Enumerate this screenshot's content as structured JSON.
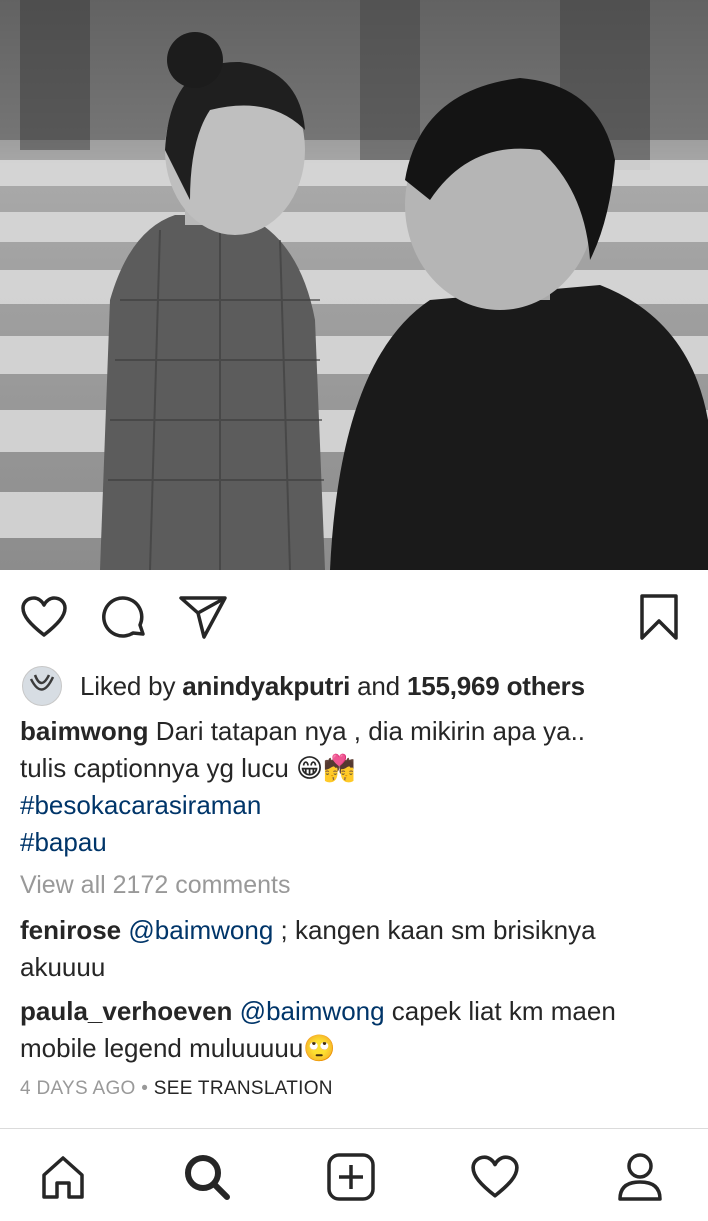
{
  "post": {
    "image_alt": "Black and white photo of a couple looking at each other on a crosswalk"
  },
  "actions": {
    "like_icon": "heart-outline-icon",
    "comment_icon": "comment-bubble-icon",
    "share_icon": "paper-plane-icon",
    "save_icon": "bookmark-outline-icon"
  },
  "likes": {
    "prefix": "Liked by ",
    "user": "anindyakputri",
    "middle": " and ",
    "count_text": "155,969 others"
  },
  "caption": {
    "username": "baimwong",
    "text_line1": "Dari tatapan nya , dia mikirin apa ya..",
    "text_line2": "tulis captionnya yg lucu 😁💏",
    "hashtags": [
      "#besokacarasiraman",
      "#bapau"
    ]
  },
  "comments_link": "View all 2172 comments",
  "comments": [
    {
      "username": "fenirose",
      "mention": "@baimwong",
      "text": " ; kangen kaan sm brisiknya akuuuu"
    },
    {
      "username": "paula_verhoeven",
      "mention": "@baimwong",
      "text": " capek liat km maen mobile legend muluuuuu🙄"
    }
  ],
  "meta": {
    "time": "4 DAYS AGO",
    "separator": " • ",
    "translate": "SEE TRANSLATION"
  },
  "bottom_nav": [
    {
      "name": "home",
      "icon": "home-icon"
    },
    {
      "name": "search",
      "icon": "search-icon"
    },
    {
      "name": "new-post",
      "icon": "add-square-icon"
    },
    {
      "name": "activity",
      "icon": "heart-icon"
    },
    {
      "name": "profile",
      "icon": "person-icon"
    }
  ],
  "colors": {
    "text": "#262626",
    "link": "#003569",
    "muted": "#999999",
    "divider": "#dbdbdb"
  }
}
